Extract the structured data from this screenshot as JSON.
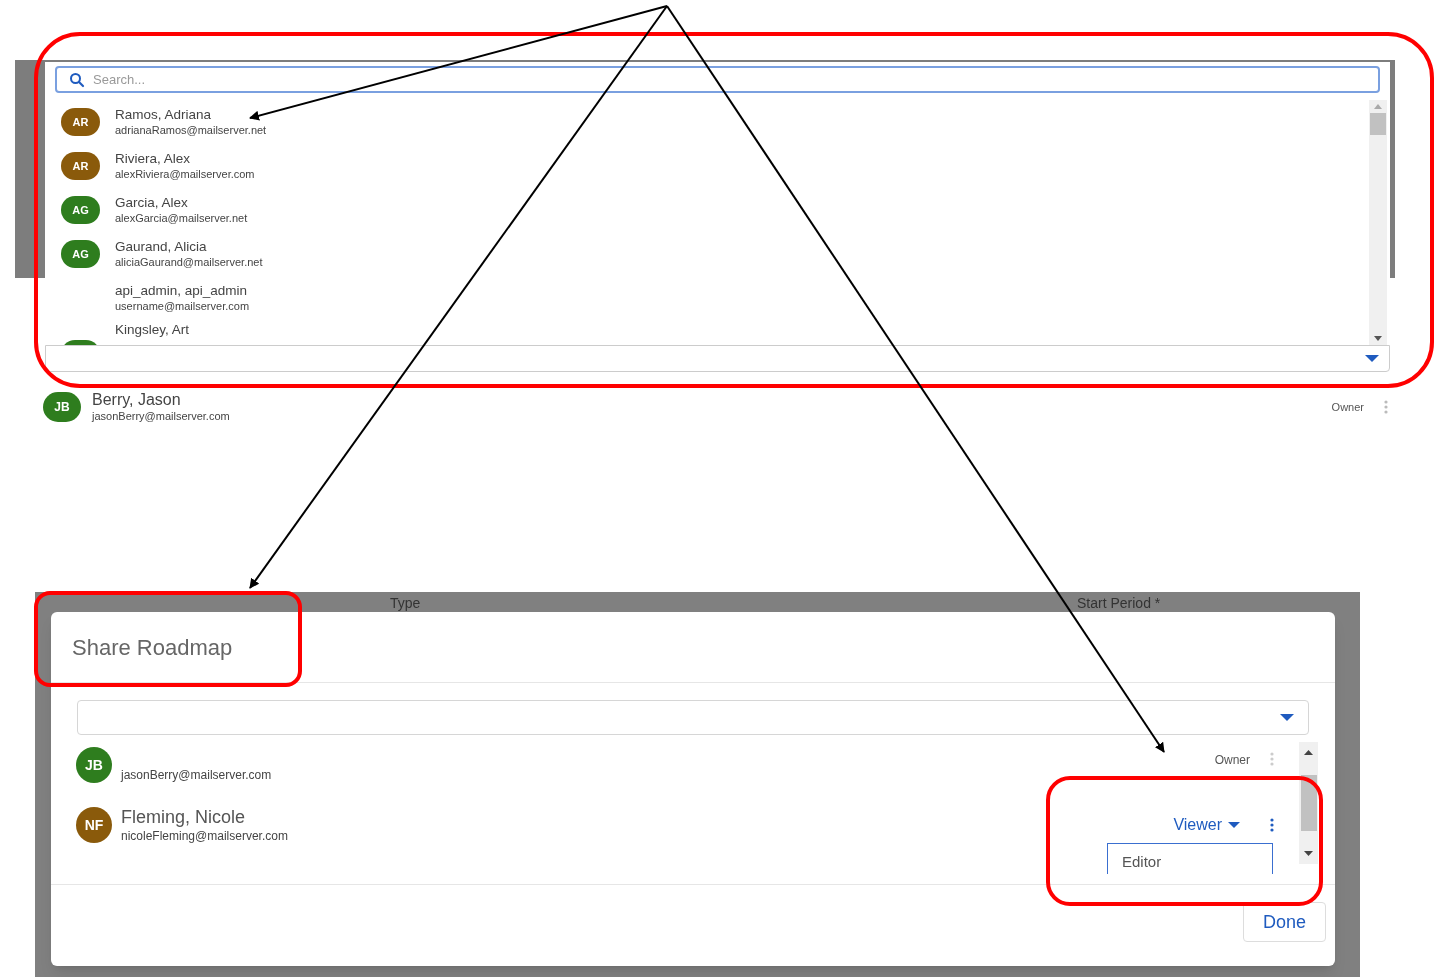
{
  "search_dropdown": {
    "placeholder": "Search...",
    "results": [
      {
        "name": "Ramos, Adriana",
        "email": "adrianaRamos@mailserver.net",
        "initials": "AR",
        "color": "#8a5a0b"
      },
      {
        "name": "Riviera, Alex",
        "email": "alexRiviera@mailserver.com",
        "initials": "AR",
        "color": "#8a5a0b"
      },
      {
        "name": "Garcia, Alex",
        "email": "alexGarcia@mailserver.net",
        "initials": "AG",
        "color": "#2e7d1e"
      },
      {
        "name": "Gaurand, Alicia",
        "email": "aliciaGaurand@mailserver.net",
        "initials": "AG",
        "color": "#2e7d1e"
      },
      {
        "name": "api_admin, api_admin",
        "email": "username@mailserver.com"
      },
      {
        "name": "Kingsley, Art",
        "color": "#2e7d1e"
      }
    ]
  },
  "owner_row": {
    "name": "Berry, Jason",
    "email": "jasonBerry@mailserver.com",
    "initials": "JB",
    "color": "#2e7d1e",
    "role": "Owner"
  },
  "share_dialog": {
    "background_columns": [
      "Type",
      "Start Period *"
    ],
    "title": "Share Roadmap",
    "members": [
      {
        "kind": "owner",
        "email": "jasonBerry@mailserver.com",
        "initials": "JB",
        "color": "#2e7d1e",
        "role": "Owner"
      },
      {
        "kind": "editable",
        "name": "Fleming, Nicole",
        "email": "nicoleFleming@mailserver.com",
        "initials": "NF",
        "color": "#8a5a0b",
        "role": "Viewer",
        "menu_open": true
      }
    ],
    "role_options": [
      "Editor"
    ],
    "done_label": "Done"
  }
}
